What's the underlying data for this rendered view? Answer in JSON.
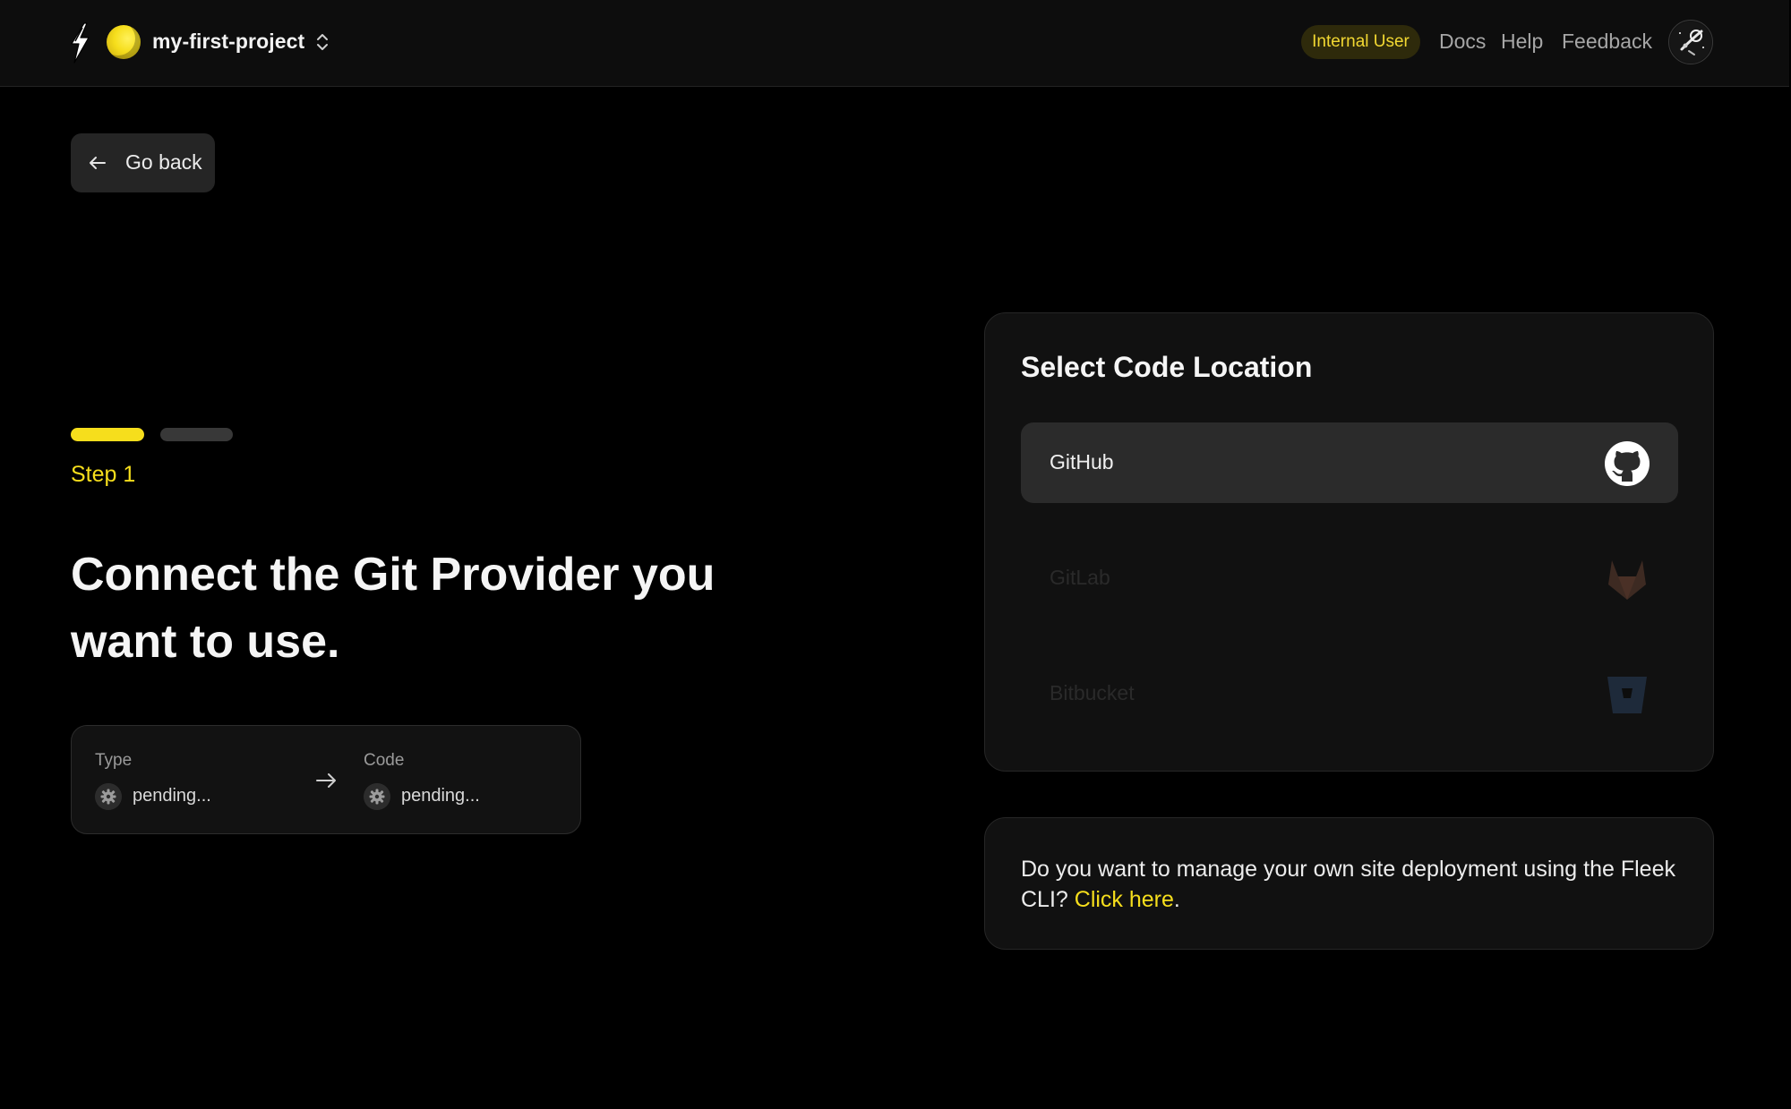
{
  "header": {
    "project_name": "my-first-project",
    "badge": "Internal User",
    "nav": {
      "docs": "Docs",
      "help": "Help",
      "feedback": "Feedback"
    },
    "icons": {
      "logo": "lightning-bolt-icon",
      "project_avatar": "yellow-circle-avatar",
      "switcher": "chevron-up-down-icon",
      "user_avatar": "user-avatar"
    }
  },
  "go_back": {
    "label": "Go back",
    "icon": "arrow-left-icon"
  },
  "stepper": {
    "total_steps": 2,
    "current_step": 1,
    "label": "Step 1"
  },
  "heading": "Connect the Git Provider you want to use.",
  "status": {
    "type": {
      "label": "Type",
      "value": "pending..."
    },
    "code": {
      "label": "Code",
      "value": "pending..."
    },
    "arrow_icon": "arrow-right-icon",
    "status_icon": "gear-icon"
  },
  "location": {
    "title": "Select Code Location",
    "providers": [
      {
        "label": "GitHub",
        "icon": "github-icon",
        "state": "enabled"
      },
      {
        "label": "GitLab",
        "icon": "gitlab-icon",
        "state": "disabled"
      },
      {
        "label": "Bitbucket",
        "icon": "bitbucket-icon",
        "state": "disabled"
      }
    ]
  },
  "cli_note": {
    "text": "Do you want to manage your own site deployment using the Fleek CLI? ",
    "link": "Click here",
    "suffix": "."
  },
  "colors": {
    "accent": "#f6de1c",
    "background": "#000000",
    "panel": "#111111",
    "selected_provider": "#2b2b2b",
    "badge_bg": "#2e2a0b"
  }
}
